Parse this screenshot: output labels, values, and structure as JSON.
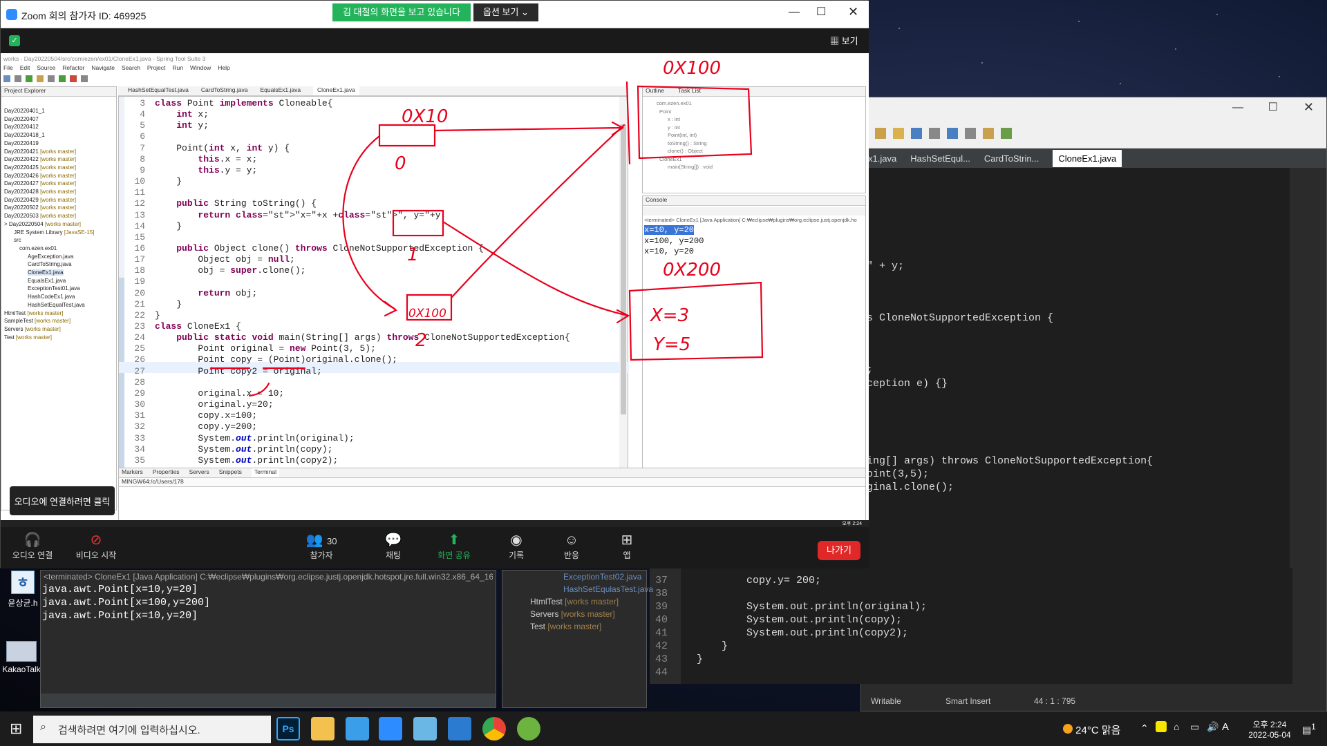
{
  "zoom": {
    "title": "Zoom 회의 참가자 ID: 469925",
    "banner": "김 대철의 화면을 보고 있습니다",
    "options": "옵션 보기",
    "view": "보기",
    "tooltip": "오디오에 연결하려면 클릭",
    "controls": {
      "audio": "오디오 연결",
      "video": "비디오 시작",
      "participants": "참가자",
      "participants_count": "30",
      "chat": "채팅",
      "share": "화면 공유",
      "record": "기록",
      "react": "반응",
      "apps": "앱",
      "leave": "나가기"
    }
  },
  "inner_eclipse": {
    "title": "works - Day20220504/src/com/ezen/ex01/CloneEx1.java - Spring Tool Suite 3",
    "menu": [
      "File",
      "Edit",
      "Source",
      "Refactor",
      "Navigate",
      "Search",
      "Project",
      "Run",
      "Window",
      "Help"
    ],
    "project_explorer": "Project Explorer",
    "projects": [
      {
        "name": "Day20220401_1",
        "meta": ""
      },
      {
        "name": "Day20220407",
        "meta": ""
      },
      {
        "name": "Day20220412",
        "meta": ""
      },
      {
        "name": "Day20220418_1",
        "meta": ""
      },
      {
        "name": "Day20220419",
        "meta": ""
      },
      {
        "name": "Day20220421",
        "meta": "[works master]"
      },
      {
        "name": "Day20220422",
        "meta": "[works master]"
      },
      {
        "name": "Day20220425",
        "meta": "[works master]"
      },
      {
        "name": "Day20220426",
        "meta": "[works master]"
      },
      {
        "name": "Day20220427",
        "meta": "[works master]"
      },
      {
        "name": "Day20220428",
        "meta": "[works master]"
      },
      {
        "name": "Day20220429",
        "meta": "[works master]"
      },
      {
        "name": "Day20220502",
        "meta": "[works master]"
      },
      {
        "name": "Day20220503",
        "meta": "[works master]"
      },
      {
        "name": "> Day20220504",
        "meta": "[works master]"
      },
      {
        "name": "JRE System Library",
        "meta": "[JavaSE-15]"
      },
      {
        "name": "src",
        "meta": ""
      },
      {
        "name": "com.ezen.ex01",
        "meta": ""
      },
      {
        "name": "AgeException.java",
        "meta": ""
      },
      {
        "name": "CardToString.java",
        "meta": ""
      },
      {
        "name": "CloneEx1.java",
        "meta": ""
      },
      {
        "name": "EqualsEx1.java",
        "meta": ""
      },
      {
        "name": "ExceptionTest01.java",
        "meta": ""
      },
      {
        "name": "HashCodeEx1.java",
        "meta": ""
      },
      {
        "name": "HashSetEqualTest.java",
        "meta": ""
      },
      {
        "name": "HtmlTest",
        "meta": "[works master]"
      },
      {
        "name": "SampleTest",
        "meta": "[works master]"
      },
      {
        "name": "Servers",
        "meta": "[works master]"
      },
      {
        "name": "Test",
        "meta": "[works master]"
      }
    ],
    "editor_tabs": [
      "HashSetEqualTest.java",
      "CardToString.java",
      "EqualsEx1.java",
      "CloneEx1.java"
    ],
    "code_lines": [
      {
        "n": "3",
        "t": "class Point implements Cloneable{"
      },
      {
        "n": "4",
        "t": "    int x;"
      },
      {
        "n": "5",
        "t": "    int y;"
      },
      {
        "n": "6",
        "t": ""
      },
      {
        "n": "7",
        "t": "    Point(int x, int y) {"
      },
      {
        "n": "8",
        "t": "        this.x = x;"
      },
      {
        "n": "9",
        "t": "        this.y = y;"
      },
      {
        "n": "10",
        "t": "    }"
      },
      {
        "n": "11",
        "t": ""
      },
      {
        "n": "12",
        "t": "    public String toString() {"
      },
      {
        "n": "13",
        "t": "        return \"x=\"+x +\", y=\"+y;"
      },
      {
        "n": "14",
        "t": "    }"
      },
      {
        "n": "15",
        "t": ""
      },
      {
        "n": "16",
        "t": "    public Object clone() throws CloneNotSupportedException {"
      },
      {
        "n": "17",
        "t": "        Object obj = null;"
      },
      {
        "n": "18",
        "t": "        obj = super.clone();"
      },
      {
        "n": "19",
        "t": ""
      },
      {
        "n": "20",
        "t": "        return obj;"
      },
      {
        "n": "21",
        "t": "    }"
      },
      {
        "n": "22",
        "t": "}"
      },
      {
        "n": "23",
        "t": "class CloneEx1 {"
      },
      {
        "n": "24",
        "t": "    public static void main(String[] args) throws CloneNotSupportedException{"
      },
      {
        "n": "25",
        "t": "        Point original = new Point(3, 5);"
      },
      {
        "n": "26",
        "t": "        Point copy = (Point)original.clone();"
      },
      {
        "n": "27",
        "t": "        Point copy2 = original;"
      },
      {
        "n": "28",
        "t": ""
      },
      {
        "n": "29",
        "t": "        original.x = 10;"
      },
      {
        "n": "30",
        "t": "        original.y=20;"
      },
      {
        "n": "31",
        "t": "        copy.x=100;"
      },
      {
        "n": "32",
        "t": "        copy.y=200;"
      },
      {
        "n": "33",
        "t": "        System.out.println(original);"
      },
      {
        "n": "34",
        "t": "        System.out.println(copy);"
      },
      {
        "n": "35",
        "t": "        System.out.println(copy2);"
      }
    ],
    "outline_tab": "Outline",
    "tasklist_tab": "Task List",
    "outline_items": [
      "com.ezen.ex01",
      "Point",
      "x : int",
      "y : int",
      "Point(int, int)",
      "toString() : String",
      "clone() : Object",
      "CloneEx1",
      "main(String[]) : void"
    ],
    "console_tab": "Console",
    "console_header": "<terminated> CloneEx1 [Java Application] C:₩eclipse₩plugins₩org.eclipse.justj.openjdk.ho",
    "console_output": [
      "x=10, y=20",
      "x=100, y=200",
      "x=10, y=20"
    ],
    "bottom_tabs": [
      "Markers",
      "Properties",
      "Servers",
      "Snippets",
      "Terminal"
    ],
    "terminal_path": "MINGW64:/c/Users/178",
    "clock": "오후 2:24"
  },
  "annotations": {
    "a1": "0X10",
    "a2": "0X100",
    "a3": "0X200",
    "a4": "X=3",
    "a5": "Y=5",
    "a6": "0X100",
    "a7": "0",
    "a8": "1",
    "a9": "2"
  },
  "right_eclipse": {
    "tabs": [
      "x1.java",
      "HashSetEqul...",
      "CardToStrin...",
      "CloneEx1.java"
    ],
    "code": [
      {
        "n": "",
        "t": "\" + y;"
      },
      {
        "n": "",
        "t": "s CloneNotSupportedException {"
      },
      {
        "n": "",
        "t": ";"
      },
      {
        "n": "",
        "t": "ception e) {}"
      },
      {
        "n": "",
        "t": "ing[] args) throws CloneNotSupportedException{"
      },
      {
        "n": "",
        "t": "oint(3,5);"
      },
      {
        "n": "",
        "t": "ginal.clone();"
      },
      {
        "n": "37",
        "t": "        copy.y= 200;"
      },
      {
        "n": "38",
        "t": ""
      },
      {
        "n": "39",
        "t": "        System.out.println(original);"
      },
      {
        "n": "40",
        "t": "        System.out.println(copy);"
      },
      {
        "n": "41",
        "t": "        System.out.println(copy2);"
      },
      {
        "n": "42",
        "t": "    }"
      },
      {
        "n": "43",
        "t": "}"
      },
      {
        "n": "44",
        "t": ""
      }
    ],
    "status": {
      "mode": "Writable",
      "insert": "Smart Insert",
      "pos": "44 : 1 : 795"
    }
  },
  "console2": {
    "header": "<terminated> CloneEx1 [Java Application] C:₩eclipse₩plugins₩org.eclipse.justj.openjdk.hotspot.jre.full.win32.x86_64_16.",
    "lines": [
      "java.awt.Point[x=10,y=20]",
      "java.awt.Point[x=100,y=200]",
      "java.awt.Point[x=10,y=20]"
    ]
  },
  "tree2": {
    "items": [
      {
        "name": "ExceptionTest02.java",
        "meta": ""
      },
      {
        "name": "HashSetEqulasTest.java",
        "meta": ""
      },
      {
        "name": "HtmlTest",
        "meta": "[works master]"
      },
      {
        "name": "Servers",
        "meta": "[works master]"
      },
      {
        "name": "Test",
        "meta": "[works master]"
      }
    ]
  },
  "desktop": {
    "icon1": "윤상균.h",
    "icon2": "KakaoTalk"
  },
  "taskbar": {
    "search_placeholder": "검색하려면 여기에 입력하십시오.",
    "weather": "24°C 맑음",
    "ime": "A",
    "time": "오후 2:24",
    "date": "2022-05-04",
    "notif": "1"
  }
}
